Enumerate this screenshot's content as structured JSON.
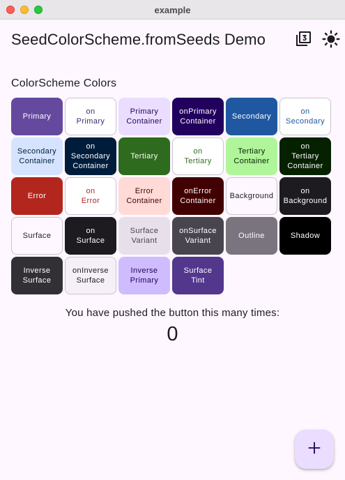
{
  "window": {
    "title": "example"
  },
  "appbar": {
    "title": "SeedColorScheme.fromSeeds Demo",
    "icons": [
      "filter-3-icon",
      "brightness-icon"
    ]
  },
  "section": {
    "title": "ColorScheme Colors"
  },
  "swatches": [
    {
      "label": "Primary",
      "bg": "#65499f",
      "fg": "#ffffff"
    },
    {
      "label": "on\nPrimary",
      "bg": "#ffffff",
      "fg": "#3b2a78"
    },
    {
      "label": "Primary\nContainer",
      "bg": "#eaddff",
      "fg": "#22005d"
    },
    {
      "label": "onPrimary\nContainer",
      "bg": "#22005d",
      "fg": "#ffffff"
    },
    {
      "label": "Secondary",
      "bg": "#1f58a0",
      "fg": "#ffffff"
    },
    {
      "label": "on\nSecondary",
      "bg": "#ffffff",
      "fg": "#1f58a0"
    },
    {
      "label": "Secondary\nContainer",
      "bg": "#d5e3ff",
      "fg": "#001c3b"
    },
    {
      "label": "on\nSecondary\nContainer",
      "bg": "#001c3b",
      "fg": "#ffffff"
    },
    {
      "label": "Tertiary",
      "bg": "#2e6b1e",
      "fg": "#ffffff"
    },
    {
      "label": "on\nTertiary",
      "bg": "#ffffff",
      "fg": "#2e6b1e"
    },
    {
      "label": "Tertiary\nContainer",
      "bg": "#b1f59b",
      "fg": "#022100"
    },
    {
      "label": "on\nTertiary\nContainer",
      "bg": "#062100",
      "fg": "#ffffff"
    },
    {
      "label": "Error",
      "bg": "#b3261e",
      "fg": "#ffffff"
    },
    {
      "label": "on\nError",
      "bg": "#ffffff",
      "fg": "#b3261e"
    },
    {
      "label": "Error\nContainer",
      "bg": "#ffdad6",
      "fg": "#410002"
    },
    {
      "label": "onError\nContainer",
      "bg": "#410002",
      "fg": "#ffffff"
    },
    {
      "label": "Background",
      "bg": "#fef7ff",
      "fg": "#1d1b20"
    },
    {
      "label": "on\nBackground",
      "bg": "#1d1b20",
      "fg": "#ffffff"
    },
    {
      "label": "Surface",
      "bg": "#fef7ff",
      "fg": "#1d1b20"
    },
    {
      "label": "on\nSurface",
      "bg": "#1d1b20",
      "fg": "#ffffff"
    },
    {
      "label": "Surface\nVariant",
      "bg": "#e7e0eb",
      "fg": "#49454f"
    },
    {
      "label": "onSurface\nVariant",
      "bg": "#49454f",
      "fg": "#ffffff"
    },
    {
      "label": "Outline",
      "bg": "#79747e",
      "fg": "#ffffff"
    },
    {
      "label": "Shadow",
      "bg": "#000000",
      "fg": "#ffffff"
    },
    {
      "label": "Inverse\nSurface",
      "bg": "#322f35",
      "fg": "#ffffff"
    },
    {
      "label": "onInverse\nSurface",
      "bg": "#f5eff7",
      "fg": "#1d1b20"
    },
    {
      "label": "Inverse\nPrimary",
      "bg": "#cfbcff",
      "fg": "#22005d"
    },
    {
      "label": "Surface\nTint",
      "bg": "#52378d",
      "fg": "#ffffff"
    }
  ],
  "counter": {
    "text": "You have pushed the button this many times:",
    "value": "0"
  },
  "fab": {
    "icon": "add-icon",
    "color": "#eaddff"
  }
}
